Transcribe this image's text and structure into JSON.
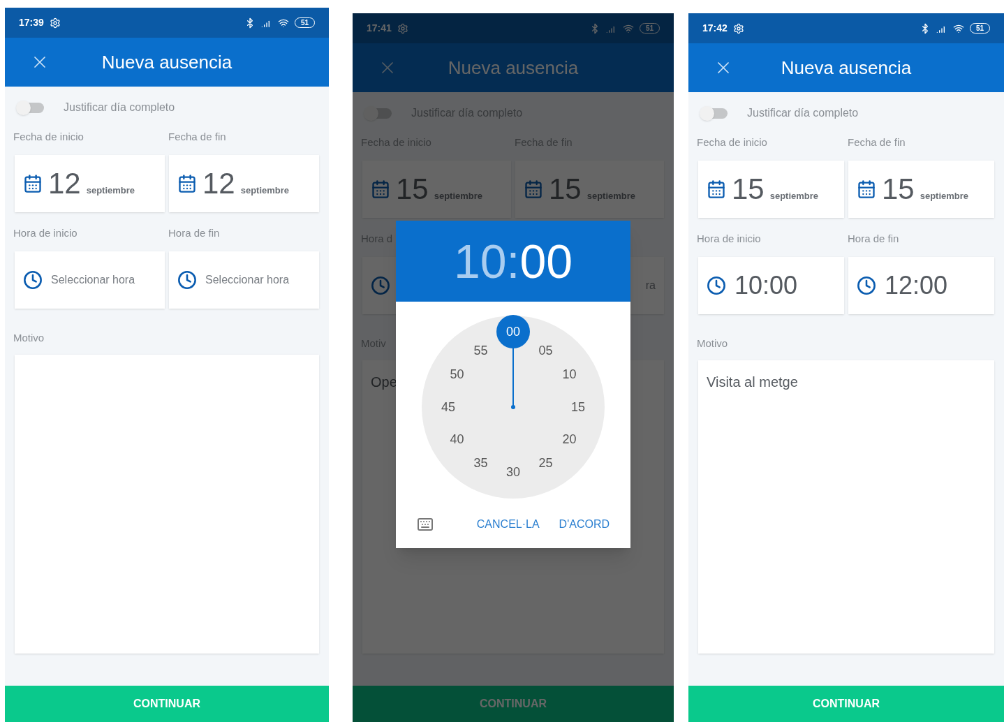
{
  "screens": [
    {
      "status_bar": {
        "time": "17:39",
        "battery": "51"
      },
      "title": "Nueva ausencia",
      "full_day": {
        "label": "Justificar día completo",
        "on": false
      },
      "start_date": {
        "label": "Fecha de inicio",
        "day": "12",
        "month": "septiembre"
      },
      "end_date": {
        "label": "Fecha de fin",
        "day": "12",
        "month": "septiembre"
      },
      "start_time": {
        "label": "Hora de inicio",
        "kind": "prompt",
        "text": "Seleccionar hora",
        "show_icon": true
      },
      "end_time": {
        "label": "Hora de fin",
        "kind": "prompt",
        "text": "Seleccionar hora",
        "show_icon": true
      },
      "reason": {
        "label": "Motivo"
      },
      "continue_button": "CONTINUAR"
    },
    {
      "status_bar": {
        "time": "17:41",
        "battery": "51"
      },
      "title": "Nueva ausencia",
      "full_day": {
        "label": "Justificar día completo",
        "on": false
      },
      "start_date": {
        "label": "Fecha de inicio",
        "day": "15",
        "month": "septiembre"
      },
      "end_date": {
        "label": "Fecha de fin",
        "day": "15",
        "month": "septiembre"
      },
      "start_time": {
        "label": "Hora d",
        "show_icon": true
      },
      "end_time": {
        "kind": "prompt",
        "text": "ra",
        "show_icon": false
      },
      "reason": {
        "label": "Motiv",
        "value": "Ope"
      },
      "continue_button": "CONTINUAR",
      "dialog": {
        "hours": "10",
        "separator": ":",
        "minutes": "00",
        "minutes_selected": true,
        "numbers": [
          {
            "label": "00",
            "selected": true
          },
          {
            "label": "05",
            "selected": false
          },
          {
            "label": "10",
            "selected": false
          },
          {
            "label": "15",
            "selected": false
          },
          {
            "label": "20",
            "selected": false
          },
          {
            "label": "25",
            "selected": false
          },
          {
            "label": "30",
            "selected": false
          },
          {
            "label": "35",
            "selected": false
          },
          {
            "label": "40",
            "selected": false
          },
          {
            "label": "45",
            "selected": false
          },
          {
            "label": "50",
            "selected": false
          },
          {
            "label": "55",
            "selected": false
          }
        ],
        "buttons": [
          "CANCEL·LA",
          "D'ACORD"
        ]
      }
    },
    {
      "status_bar": {
        "time": "17:42",
        "battery": "51"
      },
      "title": "Nueva ausencia",
      "full_day": {
        "label": "Justificar día completo",
        "on": false
      },
      "start_date": {
        "label": "Fecha de inicio",
        "day": "15",
        "month": "septiembre"
      },
      "end_date": {
        "label": "Fecha de fin",
        "day": "15",
        "month": "septiembre"
      },
      "start_time": {
        "label": "Hora de inicio",
        "kind": "time",
        "text": "10:00",
        "show_icon": true
      },
      "end_time": {
        "label": "Hora de fin",
        "kind": "time",
        "text": "12:00",
        "show_icon": true
      },
      "reason": {
        "label": "Motivo",
        "value": "Visita al metge"
      },
      "continue_button": "CONTINUAR"
    }
  ]
}
